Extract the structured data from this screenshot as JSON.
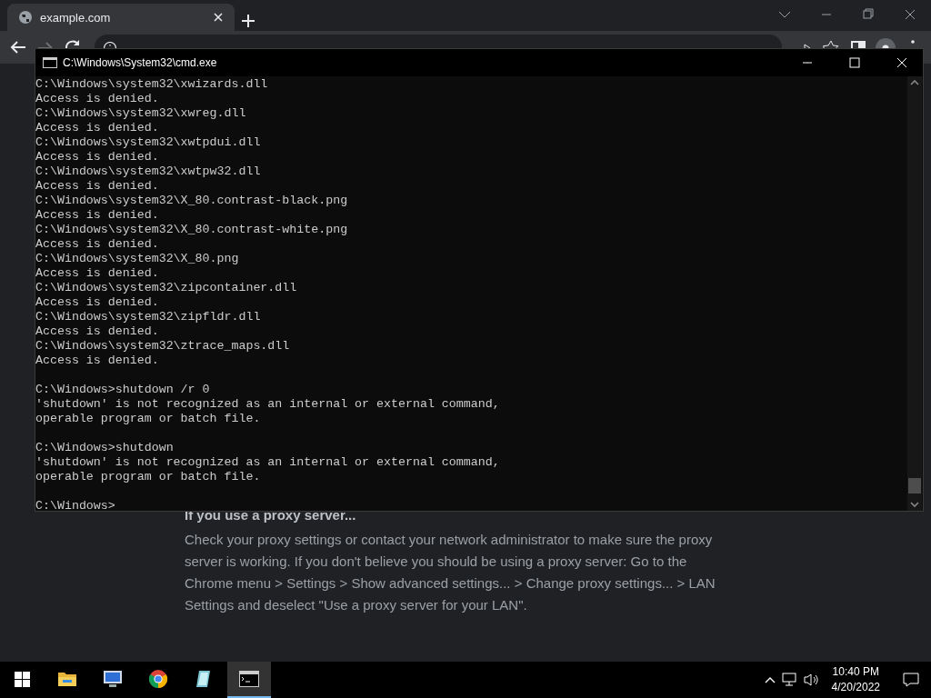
{
  "browser": {
    "tab": {
      "title": "example.com",
      "selected": true
    }
  },
  "page": {
    "heading": "If you use a proxy server...",
    "paragraph": "Check your proxy settings or contact your network administrator to make sure the proxy server is working. If you don't believe you should be using a proxy server: Go to the Chrome menu > Settings > Show advanced settings... > Change proxy settings... > LAN Settings and deselect \"Use a proxy server for your LAN\"."
  },
  "console": {
    "title": "C:\\Windows\\System32\\cmd.exe",
    "blocks": [
      [
        "C:\\Windows\\system32\\xwizards.dll",
        "Access is denied.",
        "C:\\Windows\\system32\\xwreg.dll",
        "Access is denied.",
        "C:\\Windows\\system32\\xwtpdui.dll",
        "Access is denied.",
        "C:\\Windows\\system32\\xwtpw32.dll",
        "Access is denied.",
        "C:\\Windows\\system32\\X_80.contrast-black.png",
        "Access is denied.",
        "C:\\Windows\\system32\\X_80.contrast-white.png",
        "Access is denied.",
        "C:\\Windows\\system32\\X_80.png",
        "Access is denied.",
        "C:\\Windows\\system32\\zipcontainer.dll",
        "Access is denied.",
        "C:\\Windows\\system32\\zipfldr.dll",
        "Access is denied.",
        "C:\\Windows\\system32\\ztrace_maps.dll",
        "Access is denied."
      ],
      [
        "C:\\Windows>shutdown /r 0",
        "'shutdown' is not recognized as an internal or external command,",
        "operable program or batch file."
      ],
      [
        "C:\\Windows>shutdown",
        "'shutdown' is not recognized as an internal or external command,",
        "operable program or batch file."
      ],
      [
        "C:\\Windows>"
      ]
    ]
  },
  "taskbar": {
    "apps": [
      {
        "kind": "folder",
        "selected": false
      },
      {
        "kind": "monitor",
        "selected": false
      },
      {
        "kind": "chrome",
        "selected": false
      },
      {
        "kind": "notepad",
        "selected": false
      },
      {
        "kind": "console",
        "selected": true
      }
    ],
    "time": "10:40 PM",
    "date": "4/20/2022"
  }
}
